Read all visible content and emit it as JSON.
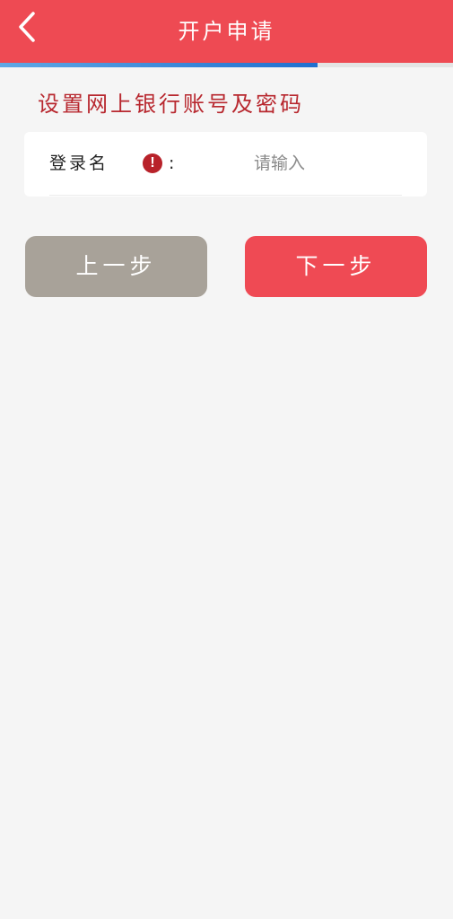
{
  "header": {
    "title": "开户申请",
    "back_icon": "chevron-left-icon",
    "background_color": "#ee4a53"
  },
  "progress": {
    "fraction": 0.7,
    "color": "#1f6fcf"
  },
  "section": {
    "title": "设置网上银行账号及密码",
    "color": "#b8282f"
  },
  "form": {
    "login_name_label": "登录名",
    "info_icon_symbol": "!",
    "colon": ":",
    "login_name_placeholder": "请输入"
  },
  "buttons": {
    "prev_label": "上一步",
    "prev_color": "#a8a299",
    "next_label": "下一步",
    "next_color": "#ef4a54"
  }
}
